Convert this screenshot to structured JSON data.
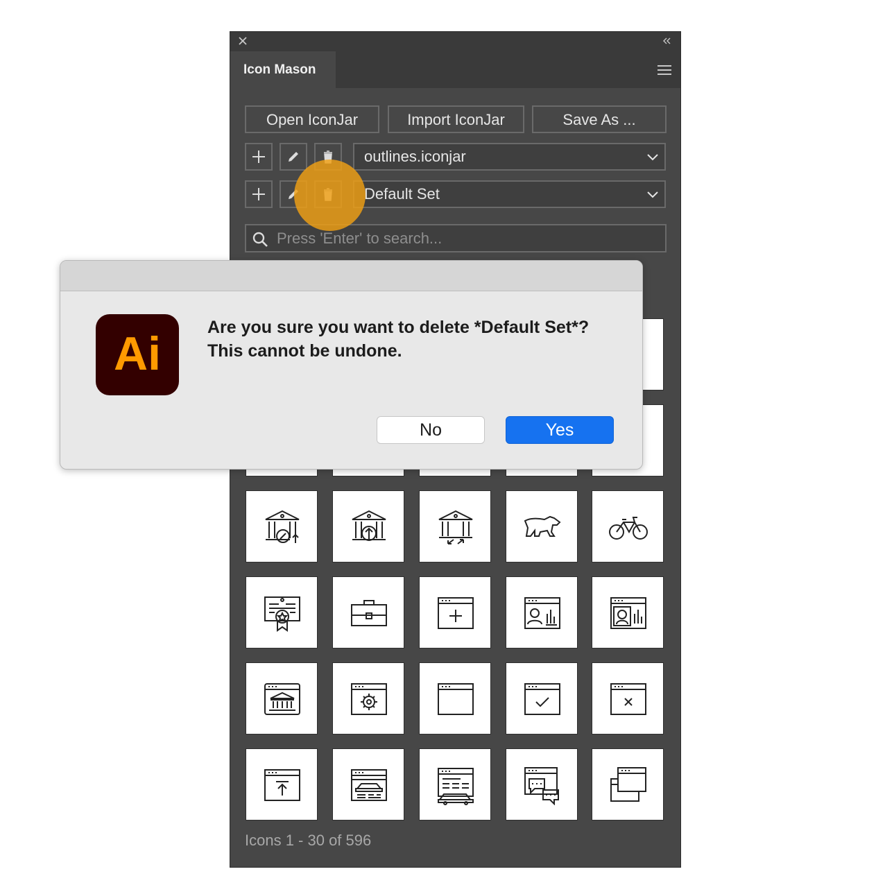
{
  "panel": {
    "tab_title": "Icon Mason",
    "buttons": {
      "open": "Open IconJar",
      "import": "Import IconJar",
      "save_as": "Save As ..."
    },
    "library_select": {
      "value": "outlines.iconjar"
    },
    "set_select": {
      "value": "Default Set"
    },
    "search": {
      "placeholder": "Press 'Enter' to search..."
    },
    "footer": "Icons 1 - 30 of 596",
    "icons_visible": [
      "bank-percent-icon",
      "bank-upload-icon",
      "bank-transfer-icon",
      "bear-icon",
      "bicycle-icon",
      "certificate-icon",
      "briefcase-icon",
      "browser-add-icon",
      "browser-user-chart-icon",
      "browser-user-chart-alt-icon",
      "browser-bank-icon",
      "browser-settings-icon",
      "browser-icon",
      "browser-check-icon",
      "browser-close-icon",
      "browser-upload-icon",
      "browser-car-icon",
      "browser-car-list-icon",
      "browser-chat-icon",
      "browser-windows-icon"
    ]
  },
  "dialog": {
    "app_icon_text": "Ai",
    "message": "Are you sure you want to delete *Default Set*? This cannot be undone.",
    "no_label": "No",
    "yes_label": "Yes"
  },
  "colors": {
    "panel_bg": "#474747",
    "accent_blue": "#1672f0",
    "highlight_orange": "#f0a014",
    "ai_icon_bg": "#330000",
    "ai_icon_text": "#ff9a00"
  }
}
